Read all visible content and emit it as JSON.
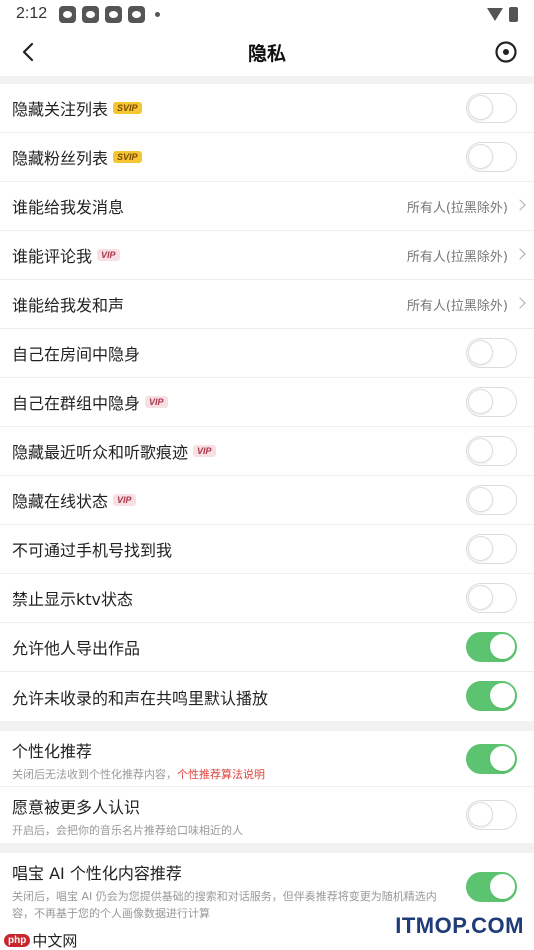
{
  "status_bar": {
    "time": "2:12",
    "notification_icons": [
      "app-icon",
      "app-icon",
      "app-icon",
      "app-icon"
    ]
  },
  "nav": {
    "title": "隐私"
  },
  "section1": {
    "rows": [
      {
        "label": "隐藏关注列表",
        "badge": "SVIP",
        "control": "toggle",
        "on": false
      },
      {
        "label": "隐藏粉丝列表",
        "badge": "SVIP",
        "control": "toggle",
        "on": false
      },
      {
        "label": "谁能给我发消息",
        "badge": "",
        "control": "value",
        "value": "所有人(拉黑除外)"
      },
      {
        "label": "谁能评论我",
        "badge": "VIP",
        "control": "value",
        "value": "所有人(拉黑除外)"
      },
      {
        "label": "谁能给我发和声",
        "badge": "",
        "control": "value",
        "value": "所有人(拉黑除外)"
      },
      {
        "label": "自己在房间中隐身",
        "badge": "",
        "control": "toggle",
        "on": false
      },
      {
        "label": "自己在群组中隐身",
        "badge": "VIP",
        "control": "toggle",
        "on": false
      },
      {
        "label": "隐藏最近听众和听歌痕迹",
        "badge": "VIP",
        "control": "toggle",
        "on": false
      },
      {
        "label": "隐藏在线状态",
        "badge": "VIP",
        "control": "toggle",
        "on": false
      },
      {
        "label": "不可通过手机号找到我",
        "badge": "",
        "control": "toggle",
        "on": false
      },
      {
        "label": "禁止显示ktv状态",
        "badge": "",
        "control": "toggle",
        "on": false
      },
      {
        "label": "允许他人导出作品",
        "badge": "",
        "control": "toggle",
        "on": true
      },
      {
        "label": "允许未收录的和声在共鸣里默认播放",
        "badge": "",
        "control": "toggle",
        "on": true
      }
    ]
  },
  "section2": {
    "rows": [
      {
        "label": "个性化推荐",
        "sub": "关闭后无法收到个性化推荐内容，",
        "link": "个性推荐算法说明",
        "on": true
      },
      {
        "label": "愿意被更多人认识",
        "sub": "开启后，会把你的音乐名片推荐给口味相近的人",
        "link": "",
        "on": false
      }
    ]
  },
  "section3": {
    "label": "唱宝 AI 个性化内容推荐",
    "sub": "关闭后，唱宝 AI 仍会为您提供基础的搜索和对话服务，但伴奏推荐将变更为随机精选内容，不再基于您的个人画像数据进行计算",
    "on": true
  },
  "watermark": {
    "brand": "ITMOP.COM",
    "left_logo": "php",
    "left_text": "中文网"
  },
  "colors": {
    "toggle_on": "#5cc470",
    "link": "#e0443f",
    "svip_badge": "#f7c531",
    "vip_badge": "#f8dfe3"
  }
}
